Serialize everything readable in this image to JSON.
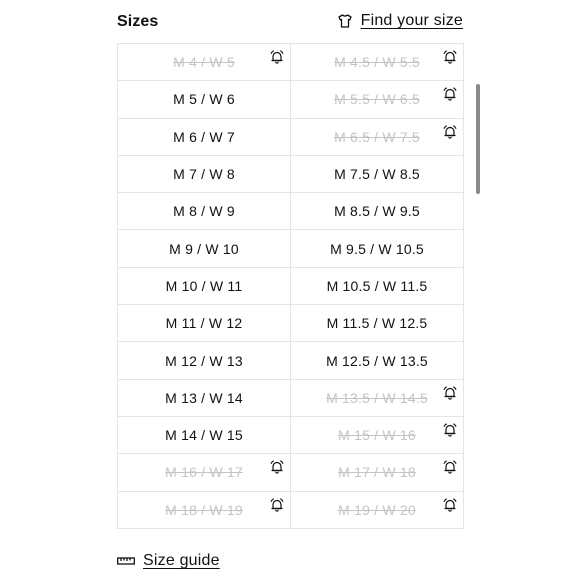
{
  "header": {
    "title": "Sizes",
    "find_size_label": "Find your size",
    "find_size_icon": "shirt-icon"
  },
  "sizes": [
    {
      "label": "M 4 / W 5",
      "available": false,
      "notify_icon": "alarm-bell-icon"
    },
    {
      "label": "M 4.5 / W 5.5",
      "available": false,
      "notify_icon": "alarm-bell-icon"
    },
    {
      "label": "M 5 / W 6",
      "available": true
    },
    {
      "label": "M 5.5 / W 6.5",
      "available": false,
      "notify_icon": "alarm-bell-icon"
    },
    {
      "label": "M 6 / W 7",
      "available": true
    },
    {
      "label": "M 6.5 / W 7.5",
      "available": false,
      "notify_icon": "alarm-bell-icon"
    },
    {
      "label": "M 7 / W 8",
      "available": true
    },
    {
      "label": "M 7.5 / W 8.5",
      "available": true
    },
    {
      "label": "M 8 / W 9",
      "available": true
    },
    {
      "label": "M 8.5 / W 9.5",
      "available": true
    },
    {
      "label": "M 9 / W 10",
      "available": true
    },
    {
      "label": "M 9.5 / W 10.5",
      "available": true
    },
    {
      "label": "M 10 / W 11",
      "available": true
    },
    {
      "label": "M 10.5 / W 11.5",
      "available": true
    },
    {
      "label": "M 11 / W 12",
      "available": true
    },
    {
      "label": "M 11.5 / W 12.5",
      "available": true
    },
    {
      "label": "M 12 / W 13",
      "available": true
    },
    {
      "label": "M 12.5 / W 13.5",
      "available": true
    },
    {
      "label": "M 13 / W 14",
      "available": true
    },
    {
      "label": "M 13.5 / W 14.5",
      "available": false,
      "notify_icon": "alarm-bell-icon"
    },
    {
      "label": "M 14 / W 15",
      "available": true
    },
    {
      "label": "M 15 / W 16",
      "available": false,
      "notify_icon": "alarm-bell-icon"
    },
    {
      "label": "M 16 / W 17",
      "available": false,
      "notify_icon": "alarm-bell-icon"
    },
    {
      "label": "M 17 / W 18",
      "available": false,
      "notify_icon": "alarm-bell-icon"
    },
    {
      "label": "M 18 / W 19",
      "available": false,
      "notify_icon": "alarm-bell-icon"
    },
    {
      "label": "M 19 / W 20",
      "available": false,
      "notify_icon": "alarm-bell-icon"
    }
  ],
  "footer": {
    "size_guide_label": "Size guide",
    "size_guide_icon": "ruler-icon"
  },
  "colors": {
    "text": "#111111",
    "unavailable_text": "#c4c4c4",
    "border": "#e5e5e5",
    "scrollbar": "#8a8a8a"
  }
}
